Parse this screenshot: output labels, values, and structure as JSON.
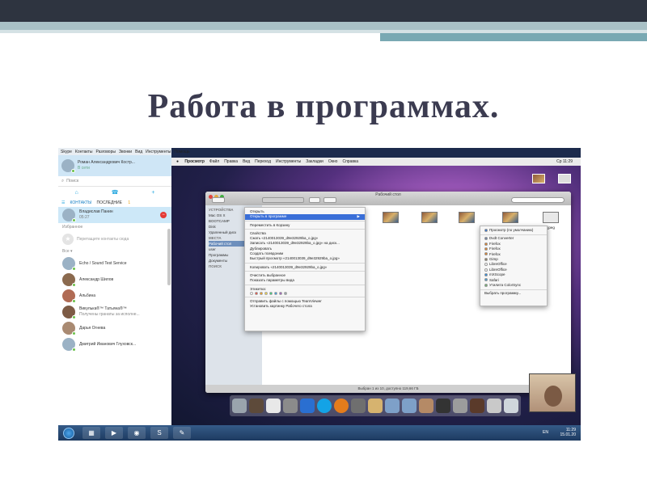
{
  "slide": {
    "title": "Работа в программах."
  },
  "colors": {
    "header": "#2e3440",
    "accent1": "#a9c1c6",
    "accent2": "#79a9b3",
    "title": "#3b3b50"
  },
  "skype": {
    "menu": [
      "Skype",
      "Контакты",
      "Разговоры",
      "Звонки",
      "Вид",
      "Инструменты",
      "Помощь"
    ],
    "me": {
      "name": "Роман Александрович Костр...",
      "status": "В сети"
    },
    "search": "Поиск",
    "tabs": {
      "contacts": "КОНТАКТЫ",
      "recent": "ПОСЛЕДНИЕ",
      "recent_count": "1"
    },
    "selected": {
      "name": "Владислав Панин",
      "time": "05:27"
    },
    "favorites": "Избранное",
    "drop_hint": "Перетащите контакты сюда",
    "all": "Все ▾",
    "contacts": [
      {
        "name": "Echo / Sound Test Service",
        "sub": ""
      },
      {
        "name": "Александр Шилов",
        "sub": ""
      },
      {
        "name": "Альбина",
        "sub": ""
      },
      {
        "name": "Викулька®™ Татьяна®™",
        "sub": "Получены гранаты за исполне..."
      },
      {
        "name": "Дарья Огнева",
        "sub": ""
      },
      {
        "name": "Дмитрий Иванович Глуховск...",
        "sub": ""
      }
    ]
  },
  "mac": {
    "menu": [
      "Просмотр",
      "Файл",
      "Правка",
      "Вид",
      "Переход",
      "Инструменты",
      "Закладки",
      "Окно",
      "Справка"
    ],
    "clock": "Ср 11:29",
    "finder_title": "Рабочий стол",
    "status": "Выбран 1 из 10, доступно 119,66 ГБ",
    "sidebar": {
      "devices_h": "УСТРОЙСТВА",
      "devices": [
        "Mac OS X",
        "BOOTCAMP",
        "Disk",
        "Удаленный диск"
      ],
      "places_h": "МЕСТА",
      "places": [
        "Рабочий стол",
        "user",
        "Программы",
        "Документы"
      ],
      "search_h": "ПОИСК"
    },
    "files": [
      {
        "name": "Пароли.doc",
        "kind": "doc"
      },
      {
        "name": "25.11.doc",
        "kind": "doc"
      },
      {
        "name": "11.jpg",
        "kind": "img"
      },
      {
        "name": "",
        "kind": "img"
      },
      {
        "name": "",
        "kind": "img"
      },
      {
        "name": "",
        "kind": "img"
      },
      {
        "name": "",
        "kind": "img"
      },
      {
        "name": ".jpeg",
        "kind": "img"
      },
      {
        "name": "новый год",
        "kind": "doc"
      },
      {
        "name": "Урок 1.doc",
        "kind": "doc"
      }
    ],
    "context_menu": [
      "Открыть",
      "Открыть в программе",
      "-",
      "Переместить в Корзину",
      "-",
      "Свойства",
      "Сжать «2140013039_d9e32929ba_o.jpg»",
      "Записать «2140013039_d9e32929ba_o.jpg» на диск...",
      "Дублировать",
      "Создать псевдоним",
      "Быстрый просмотр «2140013039_d9e32929ba_o.jpg»",
      "-",
      "Копировать «2140013039_d9e32929ba_o.jpg»",
      "-",
      "Очистить выбранное",
      "Показать параметры вида",
      "-",
      "Этикетка:",
      "TAGS",
      "-",
      "Отправить файлы с помощью TeamViewer",
      "Установить картинку Рабочего стола"
    ],
    "submenu": [
      "Просмотр (по умолчанию)",
      "-",
      "Dvdt Converter",
      "Firefox",
      "Firefox",
      "Firefox",
      "Gimp",
      "LibreOffice",
      "LibreOffice",
      "mXScope",
      "Safari",
      "Утилита ColorSync",
      "-",
      "Выбрать программу..."
    ]
  },
  "taskbar": {
    "lang": "EN",
    "time": "11:29",
    "date": "15.01.20"
  }
}
